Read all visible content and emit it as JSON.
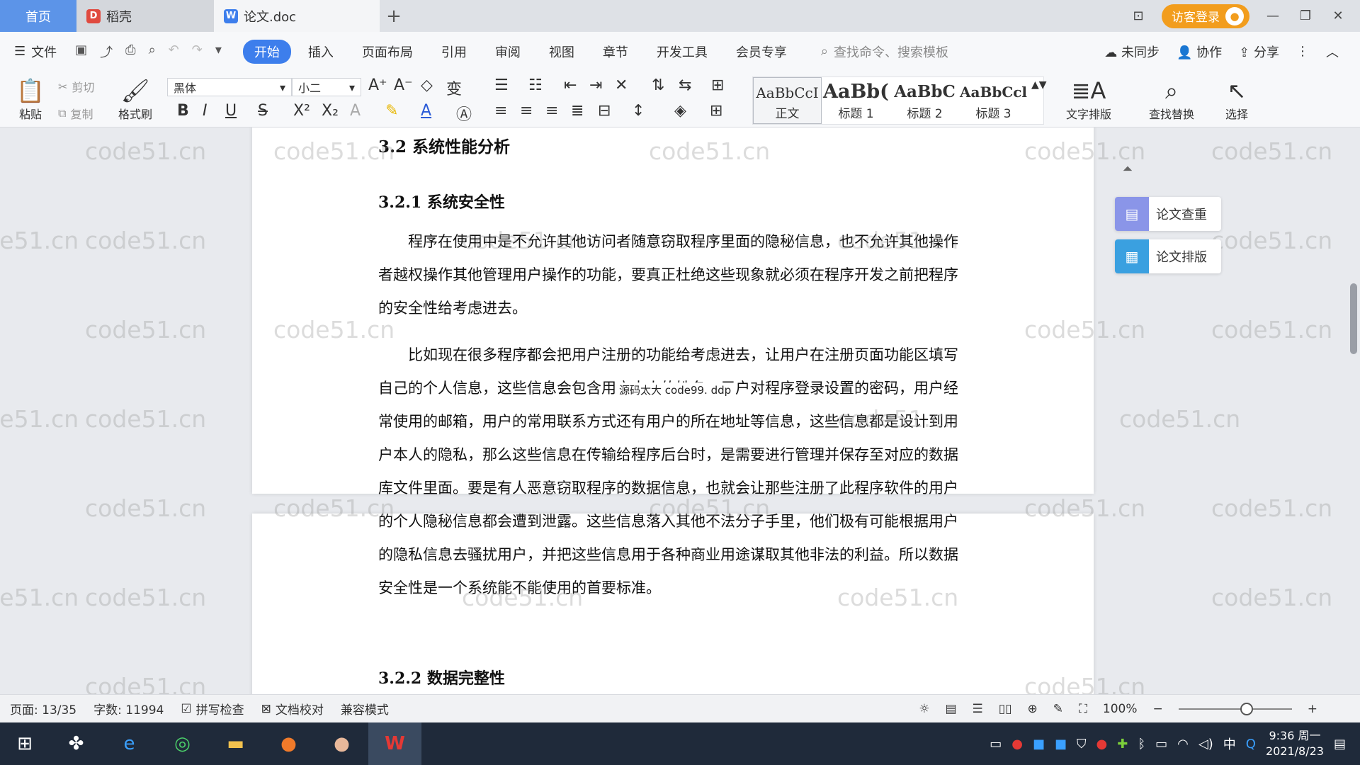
{
  "tabs": {
    "home": "首页",
    "daoke": "稻壳",
    "doc": "论文.doc",
    "add": "+"
  },
  "titlebar": {
    "visitor_login": "访客登录"
  },
  "menu": {
    "file": "文件",
    "tabs": [
      "开始",
      "插入",
      "页面布局",
      "引用",
      "审阅",
      "视图",
      "章节",
      "开发工具",
      "会员专享"
    ],
    "search_placeholder": "查找命令、搜索模板",
    "unsynced": "未同步",
    "collab": "协作",
    "share": "分享"
  },
  "ribbon": {
    "paste": "粘贴",
    "cut": "剪切",
    "copy": "复制",
    "format_painter": "格式刷",
    "font_name": "黑体",
    "font_size": "小二",
    "styles": [
      {
        "sample": "AaBbCcI",
        "name": "正文"
      },
      {
        "sample": "AaBb(",
        "name": "标题 1"
      },
      {
        "sample": "AaBbC",
        "name": "标题 2"
      },
      {
        "sample": "AaBbCcl",
        "name": "标题 3"
      }
    ],
    "text_layout": "文字排版",
    "find_replace": "查找替换",
    "select": "选择"
  },
  "document": {
    "section_heading": "3.2 系统性能分析",
    "subsection1": "3.2.1  系统安全性",
    "para1": "程序在使用中是不允许其他访问者随意窃取程序里面的隐秘信息，也不允许其他操作者越权操作其他管理用户操作的功能，要真正杜绝这些现象就必须在程序开发之前把程序的安全性给考虑进去。",
    "para2": "比如现在很多程序都会把用户注册的功能给考虑进去，让用户在注册页面功能区填写自己的个人信息，这些信息会包含用户本人的姓名，用户对程序登录设置的密码，用户经常使用的邮箱，用户的常用联系方式还有用户的所在地址等信息，这些信息都是设计到用户本人的隐私，那么这些信息在传输给程序后台时，是需要进行管理并保存至对应的数据库文件里面。要是有人恶意窃取程序的数据信息，也就会让那些注册了此程序软件的用户的个人隐秘信息都会遭到泄露。这些信息落入其他不法分子手里，他们极有可能根据用户的隐私信息去骚扰用户，并把这些信息用于各种商业用途谋取其他非法的利益。所以数据安全性是一个系统能不能使用的首要标准。",
    "subsection2": "3.2.2  数据完整性",
    "overlay_note": "源码太大 code99. ddp"
  },
  "side_panel": {
    "check": "论文查重",
    "layout": "论文排版"
  },
  "watermark": "code51.cn",
  "status": {
    "page": "页面: 13/35",
    "words": "字数: 11994",
    "spell": "拼写检查",
    "proof": "文档校对",
    "compat": "兼容模式",
    "zoom": "100%",
    "zoom_level": 0.6
  },
  "taskbar": {
    "time": "9:36 周一",
    "date": "2021/8/23",
    "ime": "中"
  },
  "colors": {
    "accent": "#3d7eec",
    "home_tab": "#5c94e8",
    "visitor": "#f29d1d",
    "side_check": "#8a95e8",
    "side_layout": "#3aa0e0"
  }
}
